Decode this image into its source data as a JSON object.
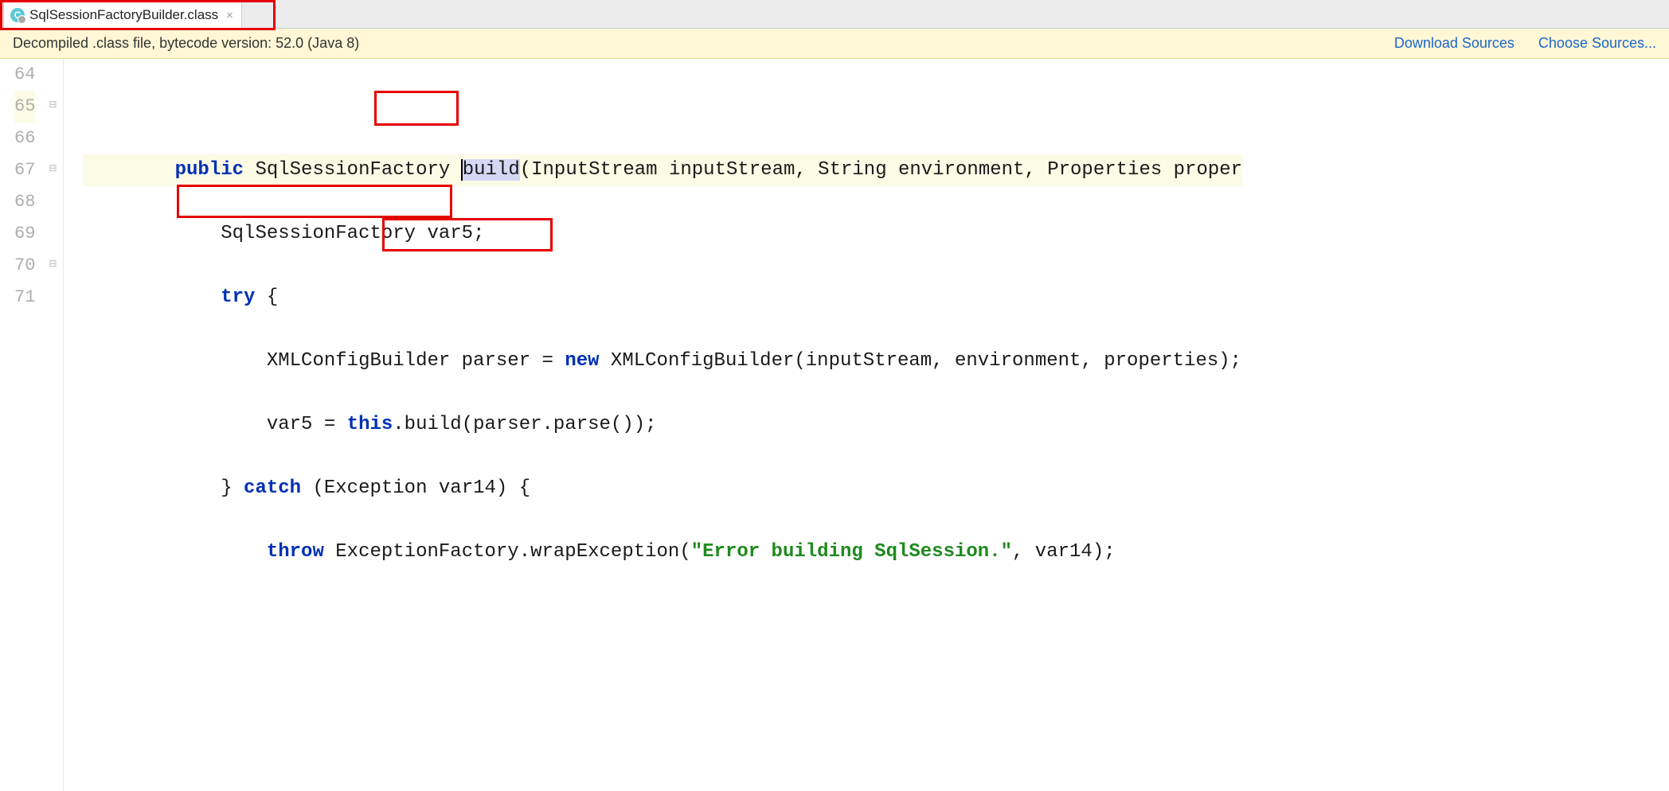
{
  "tab": {
    "label": "SqlSessionFactoryBuilder.class",
    "icon_letter": "C"
  },
  "notice": {
    "text": "Decompiled .class file, bytecode version: 52.0 (Java 8)",
    "link_download": "Download Sources",
    "link_choose": "Choose Sources..."
  },
  "gutter": [
    "64",
    "65",
    "66",
    "67",
    "68",
    "69",
    "70",
    "71"
  ],
  "code": {
    "l65": {
      "kw_public": "public",
      "t1": " SqlSessionFactory ",
      "method_b": "b",
      "method_uild": "uild",
      "t2": "(InputStream inputStream, String environment, Properties proper"
    },
    "l66": {
      "t": "SqlSessionFactory var5;"
    },
    "l67": {
      "kw_try": "try",
      "t": " {"
    },
    "l68": {
      "t1": "XMLConfigBuilder parser = ",
      "kw_new": "new",
      "t2": " XMLConfigBuilder(inputStream, environment, properties);"
    },
    "l69": {
      "t1": "var5 = ",
      "kw_this": "this",
      "t2": ".build(parser.parse());"
    },
    "l70": {
      "t1": "} ",
      "kw_catch": "catch",
      "t2": " (Exception var14) {"
    },
    "l71": {
      "kw_throw": "throw",
      "t1": " ExceptionFactory.wrapException(",
      "str": "\"Error building SqlSession.\"",
      "t2": ", var14);"
    }
  }
}
